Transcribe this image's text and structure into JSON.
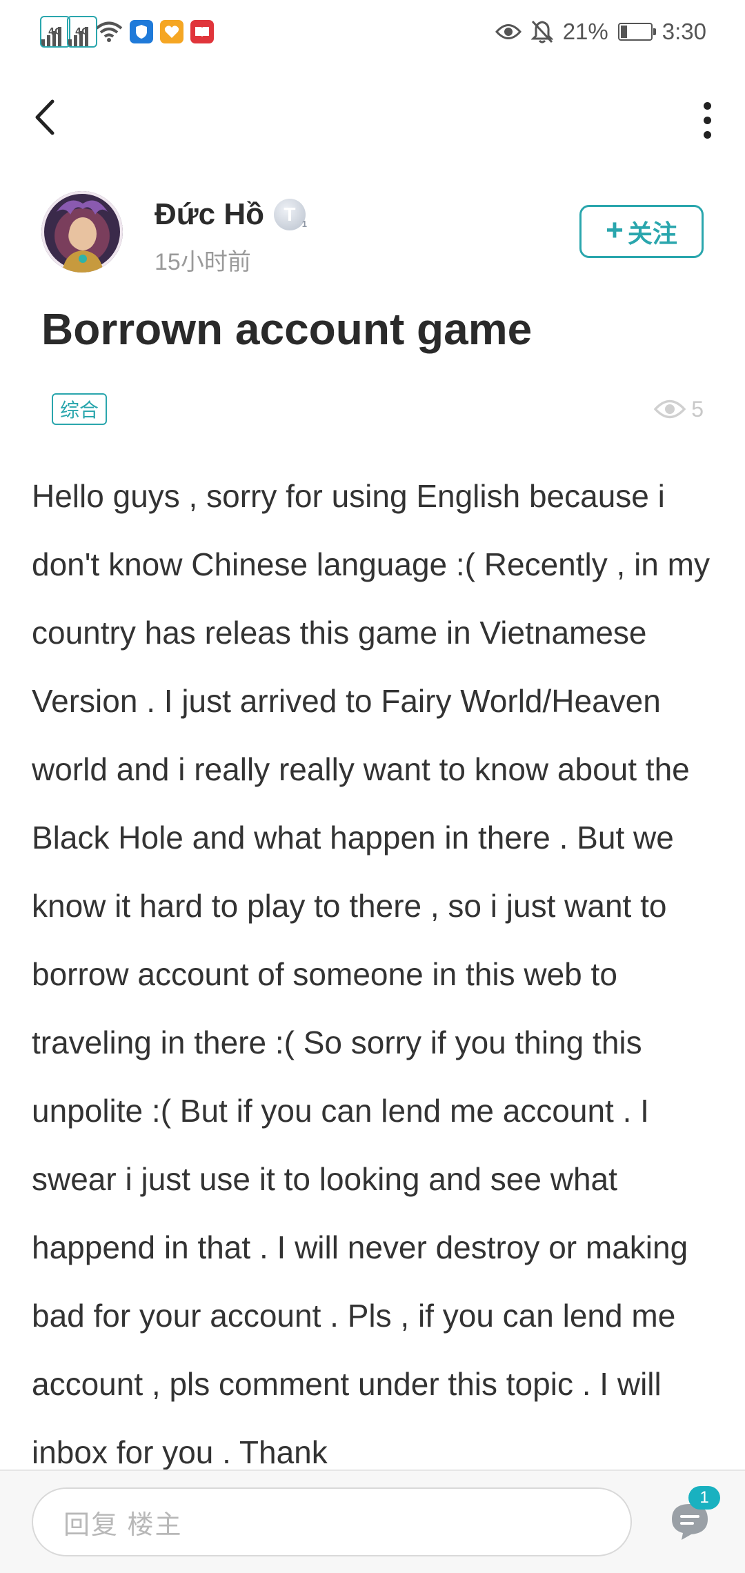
{
  "status_bar": {
    "net1": "4G",
    "net2": "4G",
    "battery": "21%",
    "time": "3:30",
    "icons": [
      "signal-icon",
      "signal-icon",
      "wifi-icon",
      "shield-app-icon",
      "heart-app-icon",
      "book-app-icon",
      "eye-icon",
      "bell-off-icon",
      "battery-icon"
    ],
    "colors": {
      "shield_app": "#1f7ad9",
      "heart_app": "#f5a623",
      "book_app": "#e0353b"
    }
  },
  "nav": {
    "back_icon": "chevron-left-icon",
    "more_icon": "more-vertical-icon"
  },
  "author": {
    "name": "Đức Hồ",
    "level_badge": "T",
    "level_number": "1",
    "time_ago": "15小时前",
    "follow_label": "关注",
    "follow_plus": "+"
  },
  "post": {
    "title": "Borrown account game",
    "tag": "综合",
    "views": "5",
    "body": "Hello guys , sorry for using English because i don't know Chinese language :( Recently , in my country has releas this game in Vietnamese Version . I just arrived to Fairy World/Heaven world and i really really want to know about the Black Hole and what happen in there . But we know it hard to play to there , so i just want to borrow account of someone in this web to traveling in there :( So sorry if you thing this unpolite :( But if you can lend me account . I swear i just use it to looking and see what happend in that . I will never destroy or making bad for your account . Pls , if you can lend me account , pls comment under this topic . I will inbox for you . Thank"
  },
  "reply_bar": {
    "placeholder": "回复  楼主",
    "comment_count": "1"
  },
  "theme": {
    "accent": "#2aa6ad",
    "badge": "#19b1c0"
  }
}
